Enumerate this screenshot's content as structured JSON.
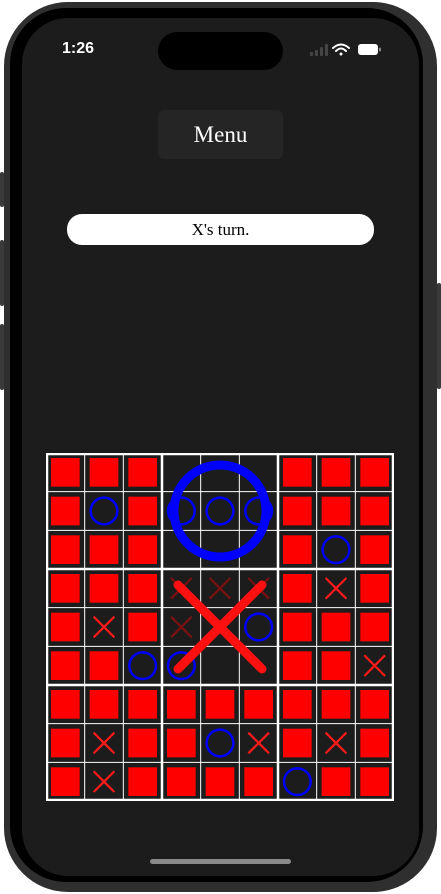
{
  "status_bar": {
    "time": "1:26",
    "icons": [
      "signal-icon",
      "wifi-icon",
      "battery-icon"
    ]
  },
  "menu": {
    "label": "Menu"
  },
  "turn_label": "X's turn.",
  "board": {
    "grid_size": 9,
    "colors": {
      "square": "#ff0000",
      "x_mark": "#ff1a1a",
      "x_dim": "#7a1010",
      "o_mark": "#0000ff",
      "big_o": "#0000ff",
      "big_x": "#ff1010",
      "lines": "#ffffff",
      "background": "#1c1c1c"
    },
    "subboards": [
      {
        "winner": "",
        "cells": [
          "S",
          "S",
          "S",
          "S",
          "O",
          "S",
          "S",
          "S",
          "S"
        ]
      },
      {
        "winner": "O",
        "cells": [
          "",
          "",
          "",
          "O",
          "O",
          "O",
          "",
          "",
          ""
        ]
      },
      {
        "winner": "",
        "cells": [
          "S",
          "S",
          "S",
          "S",
          "S",
          "S",
          "S",
          "O",
          "S"
        ]
      },
      {
        "winner": "",
        "cells": [
          "S",
          "S",
          "S",
          "S",
          "X",
          "S",
          "S",
          "S",
          "O"
        ]
      },
      {
        "winner": "X",
        "cells": [
          "x",
          "x",
          "x",
          "x",
          "",
          "O",
          "O",
          "",
          ""
        ]
      },
      {
        "winner": "",
        "cells": [
          "S",
          "X",
          "S",
          "S",
          "S",
          "S",
          "S",
          "S",
          "X"
        ]
      },
      {
        "winner": "",
        "cells": [
          "S",
          "S",
          "S",
          "S",
          "X",
          "S",
          "S",
          "X",
          "S"
        ]
      },
      {
        "winner": "",
        "cells": [
          "S",
          "S",
          "S",
          "S",
          "O",
          "X",
          "S",
          "S",
          "S"
        ]
      },
      {
        "winner": "",
        "cells": [
          "S",
          "S",
          "S",
          "S",
          "X",
          "S",
          "O",
          "S",
          "S"
        ]
      }
    ]
  }
}
